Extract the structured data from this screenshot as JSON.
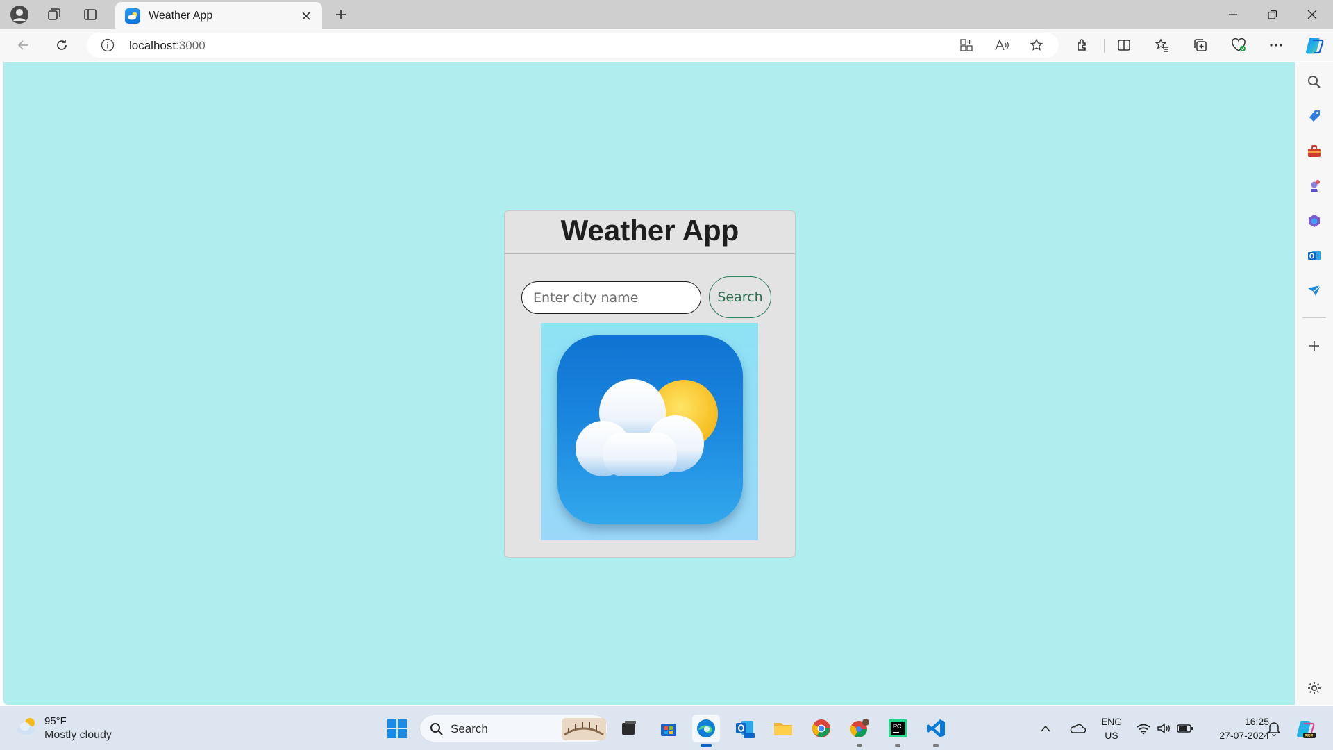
{
  "browser": {
    "tab_title": "Weather App",
    "url_host": "localhost",
    "url_port": ":3000"
  },
  "page": {
    "title": "Weather App",
    "search": {
      "placeholder": "Enter city name",
      "value": "",
      "button_label": "Search"
    },
    "image_icon": "weather-app-icon-cloud-sun"
  },
  "sidebar": {
    "icons": [
      "search-icon",
      "shopping-tag-icon",
      "tools-icon",
      "games-icon",
      "microsoft365-icon",
      "outlook-icon",
      "drop-icon",
      "add-icon",
      "settings-icon"
    ]
  },
  "taskbar": {
    "weather_temp": "95°F",
    "weather_condition": "Mostly cloudy",
    "search_label": "Search",
    "language_line1": "ENG",
    "language_line2": "US",
    "time": "16:25",
    "date": "27-07-2024"
  },
  "colors": {
    "page_background": "#aeeeee",
    "card_background": "#e3e3e3",
    "search_button_border": "#2e7d5b",
    "edge_accent": "#0a64c8"
  }
}
